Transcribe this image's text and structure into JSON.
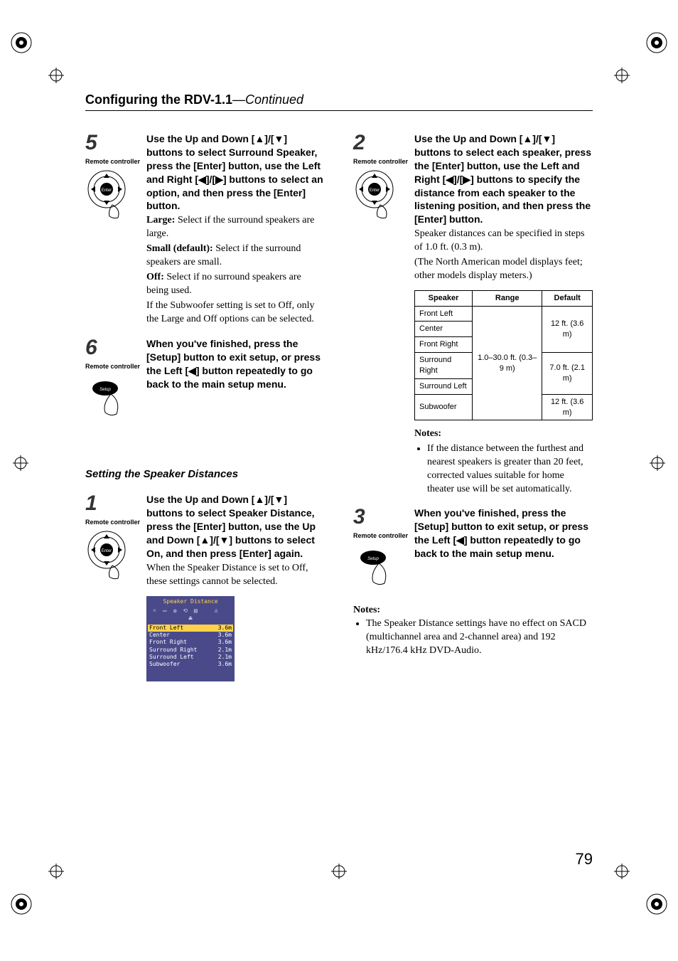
{
  "header": {
    "title_bold": "Configuring the RDV-1.1",
    "title_cont": "—Continued"
  },
  "labels": {
    "remote": "Remote controller",
    "enter": "Enter",
    "setup": "Setup",
    "notes": "Notes:"
  },
  "subtitle_distances": "Setting the Speaker Distances",
  "step5": {
    "num": "5",
    "bold": "Use the Up and Down [▲]/[▼] buttons to select Surround Speaker, press the [Enter] button, use the Left and Right [◀]/[▶] buttons to select an option, and then press the [Enter] button.",
    "large_l": "Large:",
    "large_t": " Select if the surround speakers are large.",
    "small_l": "Small (default):",
    "small_t": " Select if the surround speakers are small.",
    "off_l": "Off:",
    "off_t": " Select if no surround speakers are being used.",
    "tail": "If the Subwoofer setting is set to Off, only the Large and Off options can be selected."
  },
  "step6": {
    "num": "6",
    "bold": "When you've finished, press the [Setup] button to exit setup, or press the Left [◀] button repeatedly to go back to the main setup menu."
  },
  "step1": {
    "num": "1",
    "bold": "Use the Up and Down [▲]/[▼] buttons to select Speaker Distance, press the [Enter] button, use the Up and Down [▲]/[▼] buttons to select On, and then press [Enter] again.",
    "tail": "When the Speaker Distance is set to Off, these settings cannot be selected."
  },
  "osd": {
    "title": "Speaker Distance",
    "rows": [
      {
        "name": "Front Left",
        "val": "3.6m",
        "sel": true
      },
      {
        "name": "Center",
        "val": "3.6m",
        "sel": false
      },
      {
        "name": "Front Right",
        "val": "3.6m",
        "sel": false
      },
      {
        "name": "Surround Right",
        "val": "2.1m",
        "sel": false
      },
      {
        "name": "Surround Left",
        "val": "2.1m",
        "sel": false
      },
      {
        "name": "Subwoofer",
        "val": "3.6m",
        "sel": false
      }
    ]
  },
  "step2": {
    "num": "2",
    "bold": "Use the Up and Down [▲]/[▼] buttons to select each speaker, press the [Enter] button, use the Left and Right [◀]/[▶] buttons to specify the distance from each speaker to the listening position, and then press the [Enter] button.",
    "body1": "Speaker distances can be specified in steps of 1.0 ft. (0.3 m).",
    "body2": "(The North American model displays feet; other models display meters.)"
  },
  "table": {
    "h_speaker": "Speaker",
    "h_range": "Range",
    "h_default": "Default",
    "range": "1.0–30.0 ft. (0.3–9 m)",
    "rows": [
      {
        "name": "Front Left",
        "def": "12 ft. (3.6 m)"
      },
      {
        "name": "Center",
        "def": ""
      },
      {
        "name": "Front Right",
        "def": ""
      },
      {
        "name": "Surround Right",
        "def": "7.0 ft. (2.1 m)"
      },
      {
        "name": "Surround Left",
        "def": ""
      },
      {
        "name": "Subwoofer",
        "def": "12 ft. (3.6 m)"
      }
    ],
    "note": "If the distance between the furthest and nearest speakers is greater than 20 feet, corrected values suitable for home theater use will be set automatically."
  },
  "step3": {
    "num": "3",
    "bold": "When you've finished, press the [Setup] button to exit setup, or press the Left [◀] button repeatedly to go back to the main setup menu."
  },
  "footnote": "The Speaker Distance settings have no effect on SACD (multichannel area and 2-channel area) and 192 kHz/176.4 kHz DVD-Audio.",
  "page_number": "79"
}
